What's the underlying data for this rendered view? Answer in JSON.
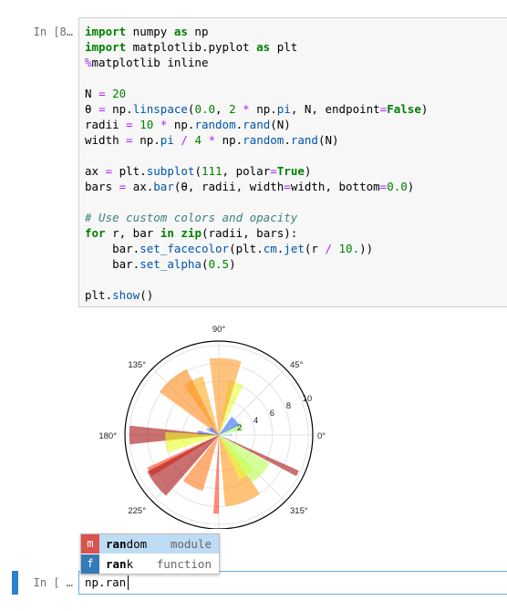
{
  "cells": {
    "cell1_prompt": "In [8…",
    "cell2_prompt": "In [ …"
  },
  "code": {
    "lines": [
      [
        {
          "t": "import",
          "c": "kw"
        },
        {
          "t": " numpy "
        },
        {
          "t": "as",
          "c": "kw"
        },
        {
          "t": " np"
        }
      ],
      [
        {
          "t": "import",
          "c": "kw"
        },
        {
          "t": " matplotlib.pyplot "
        },
        {
          "t": "as",
          "c": "kw"
        },
        {
          "t": " plt"
        }
      ],
      [
        {
          "t": "%",
          "c": "mg"
        },
        {
          "t": "matplotlib inline"
        }
      ],
      [],
      [
        {
          "t": "N "
        },
        {
          "t": "=",
          "c": "op"
        },
        {
          "t": " "
        },
        {
          "t": "20",
          "c": "num"
        }
      ],
      [
        {
          "t": "θ "
        },
        {
          "t": "=",
          "c": "op"
        },
        {
          "t": " np."
        },
        {
          "t": "linspace",
          "c": "fn"
        },
        {
          "t": "("
        },
        {
          "t": "0.0",
          "c": "num"
        },
        {
          "t": ", "
        },
        {
          "t": "2",
          "c": "num"
        },
        {
          "t": " "
        },
        {
          "t": "*",
          "c": "op"
        },
        {
          "t": " np."
        },
        {
          "t": "pi",
          "c": "fn"
        },
        {
          "t": ", N, endpoint"
        },
        {
          "t": "=",
          "c": "op"
        },
        {
          "t": "False",
          "c": "kw"
        },
        {
          "t": ")"
        }
      ],
      [
        {
          "t": "radii "
        },
        {
          "t": "=",
          "c": "op"
        },
        {
          "t": " "
        },
        {
          "t": "10",
          "c": "num"
        },
        {
          "t": " "
        },
        {
          "t": "*",
          "c": "op"
        },
        {
          "t": " np."
        },
        {
          "t": "random",
          "c": "fn"
        },
        {
          "t": "."
        },
        {
          "t": "rand",
          "c": "fn"
        },
        {
          "t": "(N)"
        }
      ],
      [
        {
          "t": "width "
        },
        {
          "t": "=",
          "c": "op"
        },
        {
          "t": " np."
        },
        {
          "t": "pi",
          "c": "fn"
        },
        {
          "t": " "
        },
        {
          "t": "/",
          "c": "op"
        },
        {
          "t": " "
        },
        {
          "t": "4",
          "c": "num"
        },
        {
          "t": " "
        },
        {
          "t": "*",
          "c": "op"
        },
        {
          "t": " np."
        },
        {
          "t": "random",
          "c": "fn"
        },
        {
          "t": "."
        },
        {
          "t": "rand",
          "c": "fn"
        },
        {
          "t": "(N)"
        }
      ],
      [],
      [
        {
          "t": "ax "
        },
        {
          "t": "=",
          "c": "op"
        },
        {
          "t": " plt."
        },
        {
          "t": "subplot",
          "c": "fn"
        },
        {
          "t": "("
        },
        {
          "t": "111",
          "c": "num"
        },
        {
          "t": ", polar"
        },
        {
          "t": "=",
          "c": "op"
        },
        {
          "t": "True",
          "c": "kw"
        },
        {
          "t": ")"
        }
      ],
      [
        {
          "t": "bars "
        },
        {
          "t": "=",
          "c": "op"
        },
        {
          "t": " ax."
        },
        {
          "t": "bar",
          "c": "fn"
        },
        {
          "t": "(θ, radii, width"
        },
        {
          "t": "=",
          "c": "op"
        },
        {
          "t": "width, bottom"
        },
        {
          "t": "=",
          "c": "op"
        },
        {
          "t": "0.0",
          "c": "num"
        },
        {
          "t": ")"
        }
      ],
      [],
      [
        {
          "t": "# Use custom colors and opacity",
          "c": "cm"
        }
      ],
      [
        {
          "t": "for",
          "c": "kw"
        },
        {
          "t": " r, bar "
        },
        {
          "t": "in",
          "c": "kw"
        },
        {
          "t": " "
        },
        {
          "t": "zip",
          "c": "kw"
        },
        {
          "t": "(radii, bars):"
        }
      ],
      [
        {
          "t": "    bar."
        },
        {
          "t": "set_facecolor",
          "c": "fn"
        },
        {
          "t": "(plt."
        },
        {
          "t": "cm",
          "c": "fn"
        },
        {
          "t": "."
        },
        {
          "t": "jet",
          "c": "fn"
        },
        {
          "t": "(r "
        },
        {
          "t": "/",
          "c": "op"
        },
        {
          "t": " "
        },
        {
          "t": "10.",
          "c": "num"
        },
        {
          "t": "))"
        }
      ],
      [
        {
          "t": "    bar."
        },
        {
          "t": "set_alpha",
          "c": "fn"
        },
        {
          "t": "("
        },
        {
          "t": "0.5",
          "c": "num"
        },
        {
          "t": ")"
        }
      ],
      [],
      [
        {
          "t": "plt."
        },
        {
          "t": "show",
          "c": "fn"
        },
        {
          "t": "()"
        }
      ]
    ]
  },
  "chart_data": {
    "type": "bar",
    "polar": true,
    "angle_tick_labels": [
      "0°",
      "45°",
      "90°",
      "135°",
      "180°",
      "225°",
      "270°",
      "315°"
    ],
    "radial_ticks": [
      2,
      4,
      6,
      8,
      10
    ],
    "rlim": [
      0,
      10.5
    ],
    "grid": true,
    "bars": [
      {
        "theta_deg": 0,
        "width_deg": 8,
        "radius": 1.5,
        "color": "#7fb0ff"
      },
      {
        "theta_deg": 22,
        "width_deg": 20,
        "radius": 2.8,
        "color": "#a8ff66"
      },
      {
        "theta_deg": 40,
        "width_deg": 30,
        "radius": 2.5,
        "color": "#3a6bff"
      },
      {
        "theta_deg": 72,
        "width_deg": 16,
        "radius": 6.2,
        "color": "#e2ff3a"
      },
      {
        "theta_deg": 85,
        "width_deg": 24,
        "radius": 8.6,
        "color": "#ff9a2a"
      },
      {
        "theta_deg": 115,
        "width_deg": 20,
        "radius": 6.8,
        "color": "#ffaa22"
      },
      {
        "theta_deg": 130,
        "width_deg": 28,
        "radius": 8.2,
        "color": "#ff8a1a"
      },
      {
        "theta_deg": 145,
        "width_deg": 22,
        "radius": 1.2,
        "color": "#2a4dff"
      },
      {
        "theta_deg": 152,
        "width_deg": 14,
        "radius": 1.5,
        "color": "#6aa0ff"
      },
      {
        "theta_deg": 174,
        "width_deg": 12,
        "radius": 2.4,
        "color": "#3a6bff"
      },
      {
        "theta_deg": 180,
        "width_deg": 12,
        "radius": 10.0,
        "color": "#a81010"
      },
      {
        "theta_deg": 188,
        "width_deg": 22,
        "radius": 6.0,
        "color": "#e8ff22"
      },
      {
        "theta_deg": 208,
        "width_deg": 7,
        "radius": 8.8,
        "color": "#ff3a1a"
      },
      {
        "theta_deg": 218,
        "width_deg": 22,
        "radius": 9.0,
        "color": "#a81010"
      },
      {
        "theta_deg": 243,
        "width_deg": 22,
        "radius": 6.5,
        "color": "#ff7a1a"
      },
      {
        "theta_deg": 268,
        "width_deg": 4,
        "radius": 8.8,
        "color": "#ff3a1a"
      },
      {
        "theta_deg": 290,
        "width_deg": 30,
        "radius": 8.0,
        "color": "#ff9a1a"
      },
      {
        "theta_deg": 305,
        "width_deg": 20,
        "radius": 5.5,
        "color": "#e8ff3a"
      },
      {
        "theta_deg": 318,
        "width_deg": 26,
        "radius": 6.5,
        "color": "#b8ff55"
      },
      {
        "theta_deg": 334,
        "width_deg": 4,
        "radius": 9.8,
        "color": "#a81010"
      }
    ]
  },
  "completion": {
    "items": [
      {
        "badge": "m",
        "badge_color": "#d9534f",
        "name_typed": "ran",
        "name_rest": "dom",
        "type": "module",
        "selected": true
      },
      {
        "badge": "f",
        "badge_color": "#337ab7",
        "name_typed": "ran",
        "name_rest": "k",
        "type": "function",
        "selected": false
      }
    ]
  },
  "input": {
    "text": "np.ran"
  }
}
